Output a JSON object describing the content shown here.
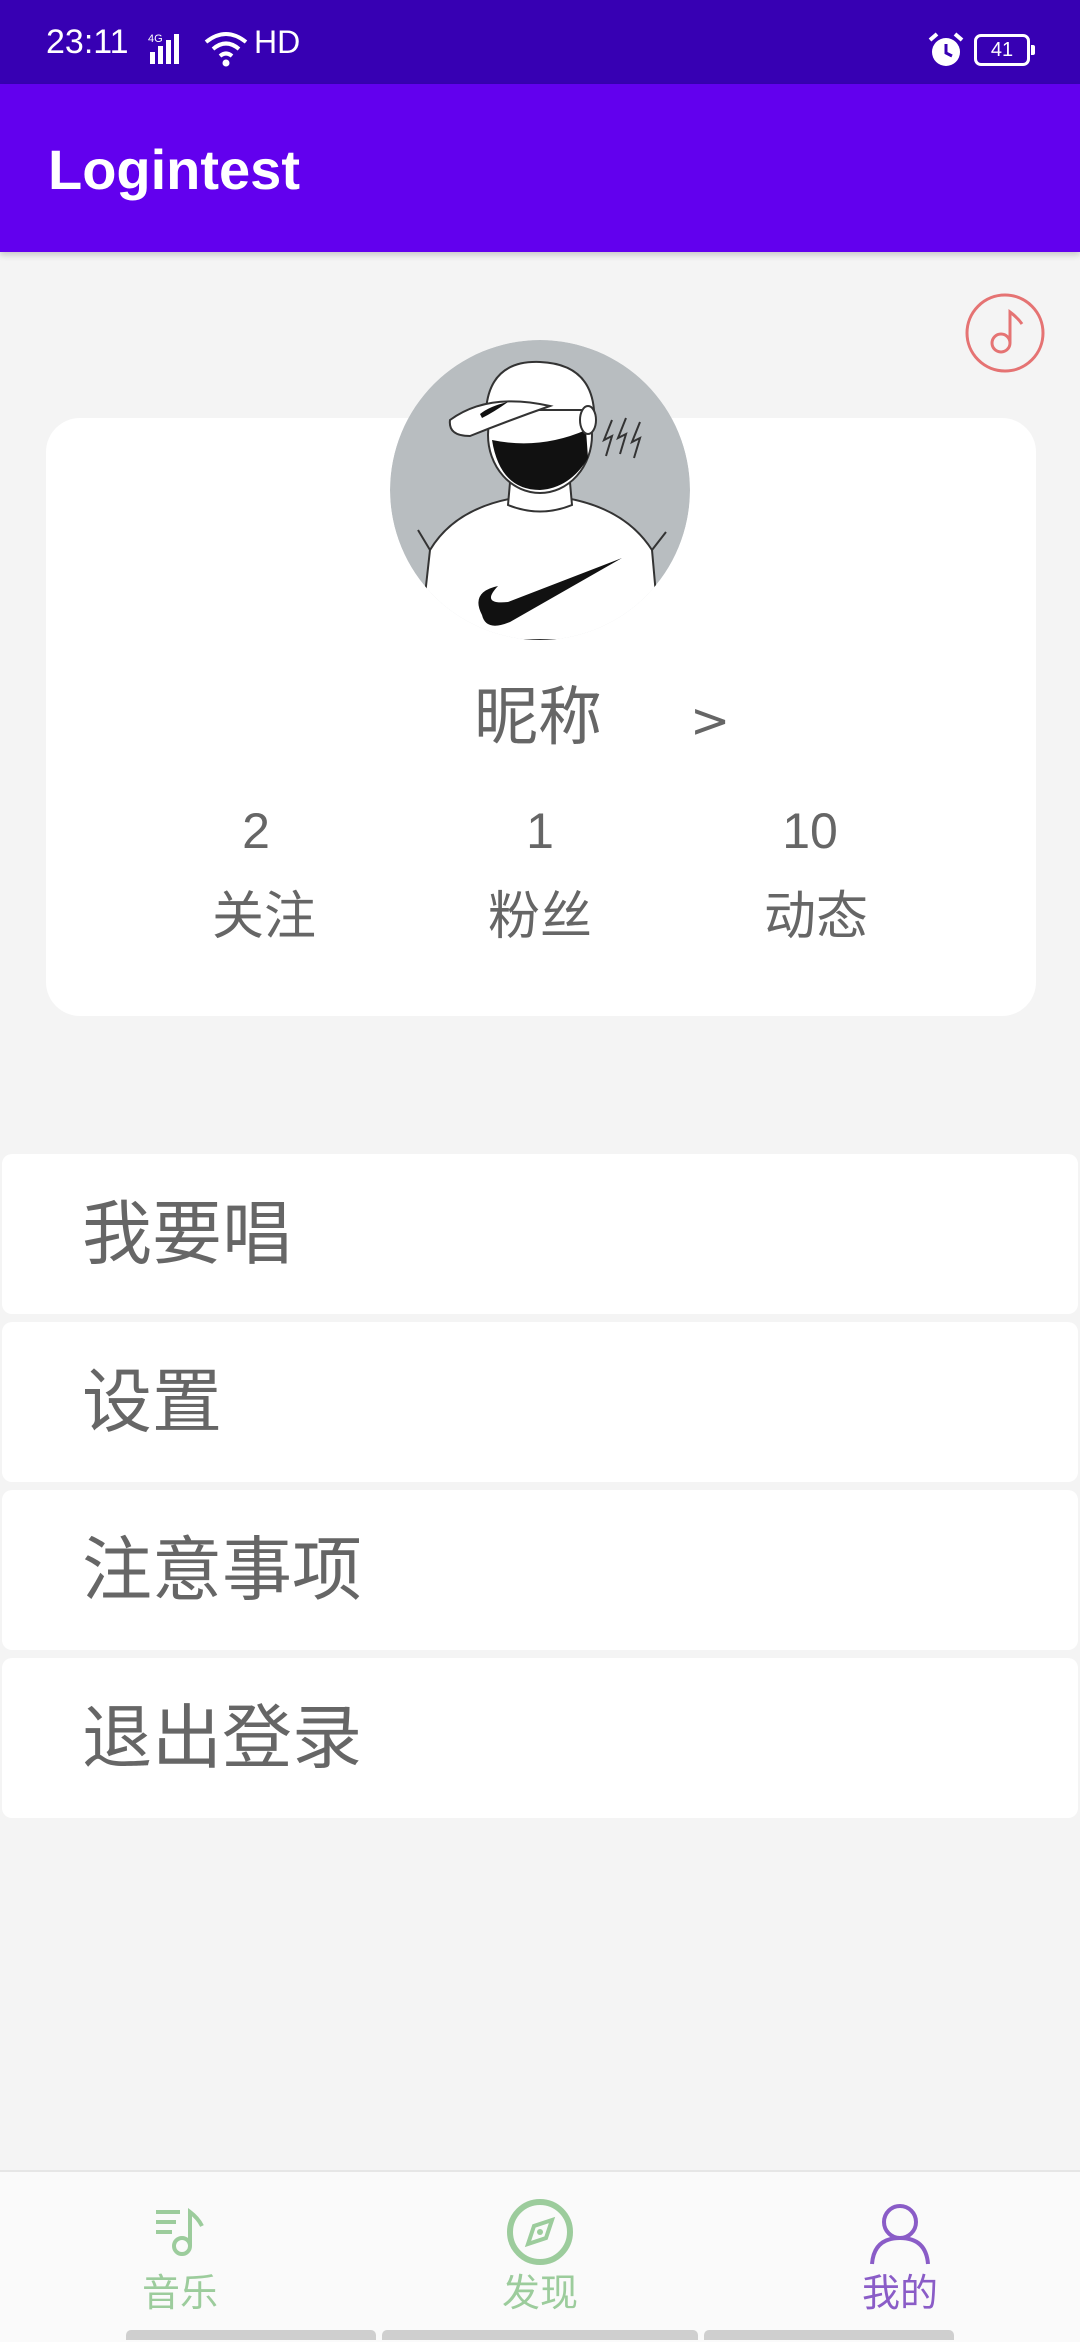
{
  "status_bar": {
    "time": "23:11",
    "network": "4G",
    "hd": "HD",
    "battery": "41"
  },
  "app_bar": {
    "title": "Logintest"
  },
  "profile": {
    "nickname": "昵称",
    "nickname_arrow": ">",
    "stats": [
      {
        "value": "2",
        "label": "关注"
      },
      {
        "value": "1",
        "label": "粉丝"
      },
      {
        "value": "10",
        "label": "动态"
      }
    ]
  },
  "menu": {
    "items": [
      {
        "label": "我要唱"
      },
      {
        "label": "设置"
      },
      {
        "label": "注意事项"
      },
      {
        "label": "退出登录"
      }
    ]
  },
  "bottom_nav": {
    "items": [
      {
        "label": "音乐",
        "icon": "music-note-icon"
      },
      {
        "label": "发现",
        "icon": "compass-icon"
      },
      {
        "label": "我的",
        "icon": "person-icon"
      }
    ],
    "selected": "我的"
  },
  "colors": {
    "status_bar": "#3700b3",
    "app_bar": "#6200ee",
    "nav_inactive": "#9ccc9c",
    "nav_active": "#8a5cc7",
    "music_icon": "#e57373"
  }
}
